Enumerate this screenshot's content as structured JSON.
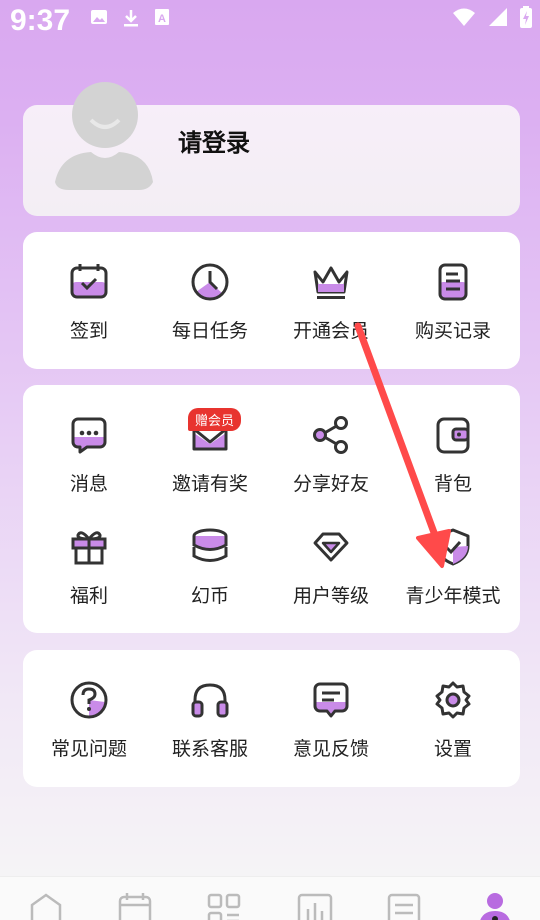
{
  "status_bar": {
    "time": "9:37",
    "left_icons": [
      "image-icon",
      "download-icon",
      "text-icon"
    ],
    "right_icons": [
      "wifi-icon",
      "signal-icon",
      "battery-icon"
    ]
  },
  "profile": {
    "login_label": "请登录"
  },
  "quick_actions": [
    {
      "label": "签到",
      "icon": "calendar-check-icon"
    },
    {
      "label": "每日任务",
      "icon": "clock-icon"
    },
    {
      "label": "开通会员",
      "icon": "crown-icon"
    },
    {
      "label": "购买记录",
      "icon": "receipt-icon"
    }
  ],
  "features": [
    {
      "label": "消息",
      "icon": "message-icon"
    },
    {
      "label": "邀请有奖",
      "icon": "invite-mail-icon",
      "badge": "赠会员"
    },
    {
      "label": "分享好友",
      "icon": "share-icon"
    },
    {
      "label": "背包",
      "icon": "wallet-icon"
    },
    {
      "label": "福利",
      "icon": "gift-icon"
    },
    {
      "label": "幻币",
      "icon": "coins-icon"
    },
    {
      "label": "用户等级",
      "icon": "diamond-icon"
    },
    {
      "label": "青少年模式",
      "icon": "shield-icon"
    }
  ],
  "support": [
    {
      "label": "常见问题",
      "icon": "question-icon"
    },
    {
      "label": "联系客服",
      "icon": "headset-icon"
    },
    {
      "label": "意见反馈",
      "icon": "feedback-icon"
    },
    {
      "label": "设置",
      "icon": "gear-icon"
    }
  ],
  "bottom_nav": [
    {
      "icon": "home-icon"
    },
    {
      "icon": "calendar-icon"
    },
    {
      "icon": "grid-icon"
    },
    {
      "icon": "chart-icon"
    },
    {
      "icon": "list-icon"
    },
    {
      "icon": "profile-icon"
    }
  ],
  "colors": {
    "accent": "#b86be0",
    "badge": "#e8342f",
    "annotation_arrow": "#ff4a4a"
  }
}
